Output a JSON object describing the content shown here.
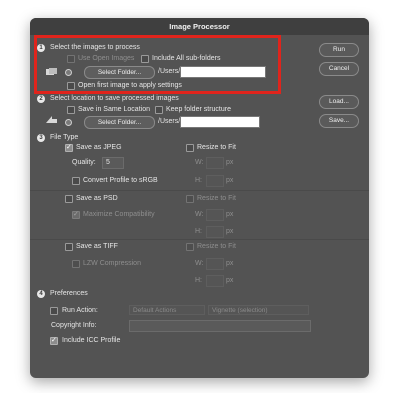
{
  "window": {
    "title": "Image Processor"
  },
  "section1": {
    "number": "1",
    "heading": "Select the images to process",
    "use_open_images": "Use Open Images",
    "include_subfolders": "Include All sub-folders",
    "select_folder": "Select Folder...",
    "path_prefix": "/Users/",
    "open_first_image": "Open first image to apply settings"
  },
  "section2": {
    "number": "2",
    "heading": "Select location to save processed images",
    "save_same_location": "Save in Same Location",
    "keep_folder_structure": "Keep folder structure",
    "select_folder": "Select Folder...",
    "path_prefix": "/Users/"
  },
  "section3": {
    "number": "3",
    "heading": "File Type",
    "jpeg": {
      "label": "Save as JPEG",
      "resize": "Resize to Fit",
      "quality_label": "Quality:",
      "quality_value": "5",
      "convert": "Convert Profile to sRGB",
      "w": "W:",
      "h": "H:",
      "unit": "px"
    },
    "psd": {
      "label": "Save as PSD",
      "resize": "Resize to Fit",
      "maximize": "Maximize Compatibility",
      "w": "W:",
      "h": "H:",
      "unit": "px"
    },
    "tiff": {
      "label": "Save as TIFF",
      "resize": "Resize to Fit",
      "lzw": "LZW Compression",
      "w": "W:",
      "h": "H:",
      "unit": "px"
    }
  },
  "section4": {
    "number": "4",
    "heading": "Preferences",
    "run_action": "Run Action:",
    "action_set": "Default Actions",
    "action": "Vignette (selection)",
    "copyright": "Copyright Info:",
    "include_icc": "Include ICC Profile"
  },
  "buttons": {
    "run": "Run",
    "cancel": "Cancel",
    "load": "Load...",
    "save": "Save..."
  },
  "colors": {
    "highlight": "#e0241c",
    "dialog_bg": "#535353"
  }
}
